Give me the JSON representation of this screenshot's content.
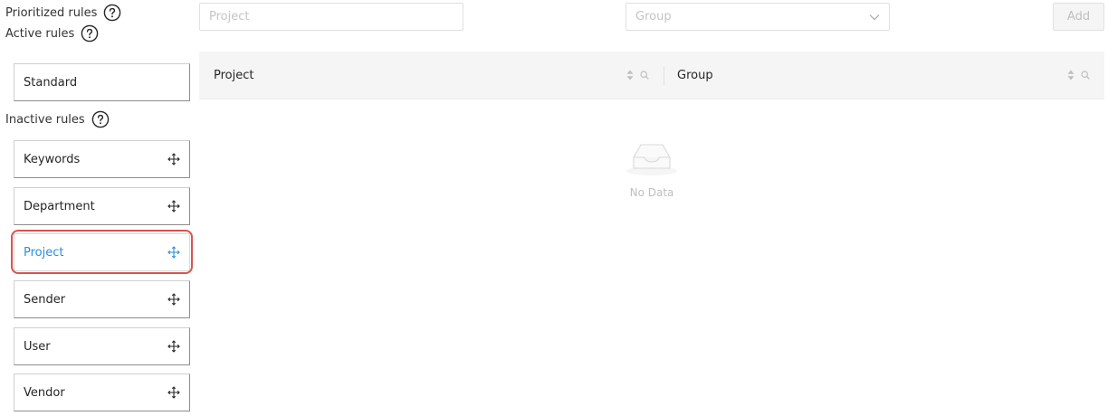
{
  "sidebar": {
    "prioritized_label": "Prioritized rules",
    "active_label": "Active rules",
    "inactive_label": "Inactive rules",
    "active_rules": [
      "Standard"
    ],
    "inactive_rules": [
      "Keywords",
      "Department",
      "Project",
      "Sender",
      "User",
      "Vendor"
    ],
    "selected_rule": "Project"
  },
  "form": {
    "project_placeholder": "Project",
    "group_placeholder": "Group",
    "add_label": "Add"
  },
  "table": {
    "columns": [
      "Project",
      "Group"
    ],
    "empty_text": "No Data"
  },
  "colors": {
    "accent": "#2d8ed9",
    "highlight": "#d9534f"
  }
}
